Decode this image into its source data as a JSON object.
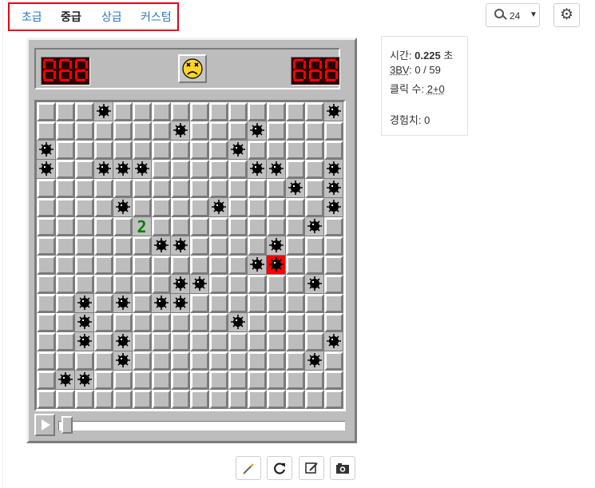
{
  "nav": {
    "items": [
      "초급",
      "중급",
      "상급",
      "커스텀"
    ],
    "active": 1
  },
  "zoom": {
    "value": "24"
  },
  "stats": {
    "time_label": "시간: ",
    "time_value": "0.225",
    "time_unit": " 초",
    "bv_label": "3BV",
    "bv_value": ": 0 / 59",
    "clicks_label": "클릭 수: ",
    "clicks_value": "2+0",
    "exp_label": "경험치: 0"
  },
  "game": {
    "mine_counter": "888",
    "time_counter": "888",
    "face": "dead-face",
    "cols": 16,
    "rows": 16,
    "mines": [
      [
        0,
        3
      ],
      [
        0,
        15
      ],
      [
        1,
        7
      ],
      [
        1,
        11
      ],
      [
        2,
        0
      ],
      [
        2,
        10
      ],
      [
        3,
        0
      ],
      [
        3,
        3
      ],
      [
        3,
        4
      ],
      [
        3,
        5
      ],
      [
        3,
        11
      ],
      [
        3,
        12
      ],
      [
        3,
        15
      ],
      [
        4,
        13
      ],
      [
        4,
        15
      ],
      [
        5,
        4
      ],
      [
        5,
        9
      ],
      [
        5,
        15
      ],
      [
        6,
        14
      ],
      [
        7,
        6
      ],
      [
        7,
        7
      ],
      [
        7,
        12
      ],
      [
        8,
        11
      ],
      [
        8,
        12
      ],
      [
        9,
        7
      ],
      [
        9,
        8
      ],
      [
        9,
        14
      ],
      [
        10,
        2
      ],
      [
        10,
        4
      ],
      [
        10,
        6
      ],
      [
        10,
        7
      ],
      [
        11,
        2
      ],
      [
        11,
        10
      ],
      [
        12,
        2
      ],
      [
        12,
        4
      ],
      [
        12,
        15
      ],
      [
        13,
        4
      ],
      [
        13,
        14
      ],
      [
        14,
        1
      ],
      [
        14,
        2
      ]
    ],
    "exploded": [
      8,
      12
    ],
    "numbers": [
      {
        "row": 6,
        "col": 5,
        "value": "2",
        "color": "#008000"
      }
    ],
    "replay_progress": 0
  },
  "colors": {
    "accent": "#2a79b8",
    "highlight": "#e4001b",
    "exploded": "#ff0000"
  },
  "toolbar": {
    "icons": [
      "wand-icon",
      "restart-icon",
      "edit-icon",
      "camera-icon"
    ]
  }
}
